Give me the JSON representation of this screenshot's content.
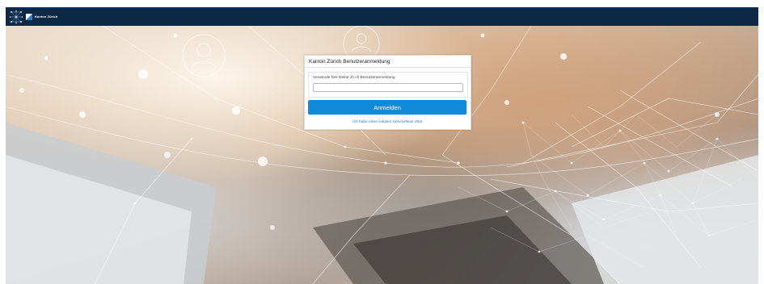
{
  "header": {
    "brand_text": "Kanton Zürich",
    "logo_icon": "zurich-network-logo-icon",
    "flag_icon": "zurich-flag-icon",
    "bar_color": "#0e2945"
  },
  "login": {
    "title": "Kanton Zürich Benutzeranmeldung",
    "field_label": "Verwende hier Deine zh.ch Benutzeranmeldung",
    "input_value": "",
    "input_placeholder": "",
    "submit_label": "Anmelden",
    "local_user_link": "Ich habe einen lokalen ServiceNow User",
    "button_color": "#1289d8",
    "link_color": "#2a79c7"
  },
  "background": {
    "description_icon": "laptop-network-background-image"
  }
}
